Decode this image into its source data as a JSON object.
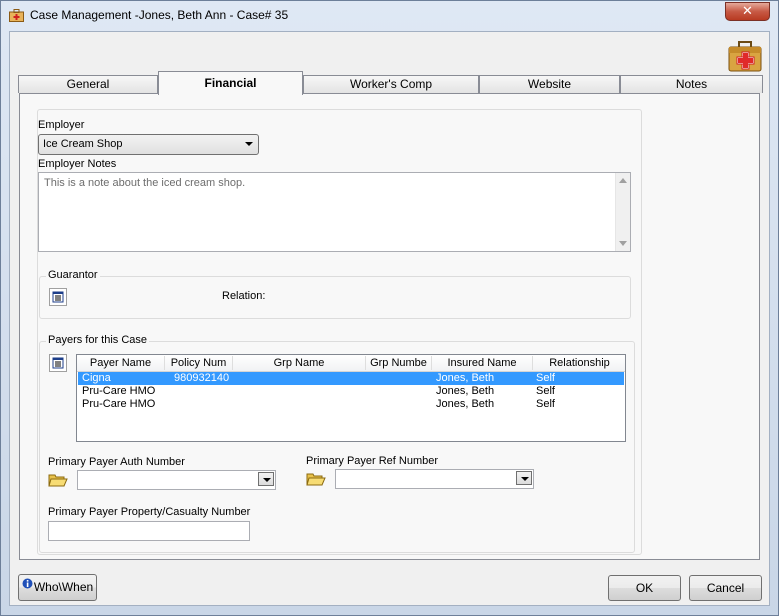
{
  "window": {
    "title": "Case Management -Jones, Beth Ann - Case#  35",
    "close_label": "✕"
  },
  "tabs": [
    {
      "label": "General",
      "active": false
    },
    {
      "label": "Financial",
      "active": true
    },
    {
      "label": "Worker's Comp",
      "active": false
    },
    {
      "label": "Website",
      "active": false
    },
    {
      "label": "Notes",
      "active": false
    }
  ],
  "employer": {
    "label": "Employer",
    "selected": "Ice Cream Shop",
    "notes_label": "Employer Notes",
    "notes_value": "This is a note about the iced cream shop."
  },
  "guarantor": {
    "group_label": "Guarantor",
    "relation_label": "Relation:"
  },
  "payers": {
    "group_label": "Payers for this Case",
    "columns": [
      "Payer Name",
      "Policy Num",
      "Grp Name",
      "Grp Numbe",
      "Insured Name",
      "Relationship"
    ],
    "rows": [
      {
        "payer": "Cigna",
        "policy": "980932140",
        "grp_name": "",
        "grp_num": "",
        "insured": "Jones, Beth",
        "relationship": "Self",
        "selected": true
      },
      {
        "payer": "Pru-Care HMO",
        "policy": "",
        "grp_name": "",
        "grp_num": "",
        "insured": "Jones, Beth",
        "relationship": "Self",
        "selected": false
      },
      {
        "payer": "Pru-Care HMO",
        "policy": "",
        "grp_name": "",
        "grp_num": "",
        "insured": "Jones, Beth",
        "relationship": "Self",
        "selected": false
      }
    ],
    "auth_label": "Primary Payer Auth Number",
    "auth_value": "",
    "ref_label": "Primary Payer Ref Number",
    "ref_value": "",
    "casualty_label": "Primary Payer Property/Casualty Number",
    "casualty_value": ""
  },
  "footer": {
    "who_when_label": "Who\\When",
    "ok_label": "OK",
    "cancel_label": "Cancel"
  },
  "colors": {
    "selection": "#3399ff",
    "close_button": "#c75a45",
    "tab_border": "#898c95"
  },
  "icons": {
    "title": "case-management-icon",
    "case": "first-aid-briefcase-icon",
    "list": "list-select-icon",
    "folder": "open-folder-icon",
    "info": "info-icon"
  }
}
